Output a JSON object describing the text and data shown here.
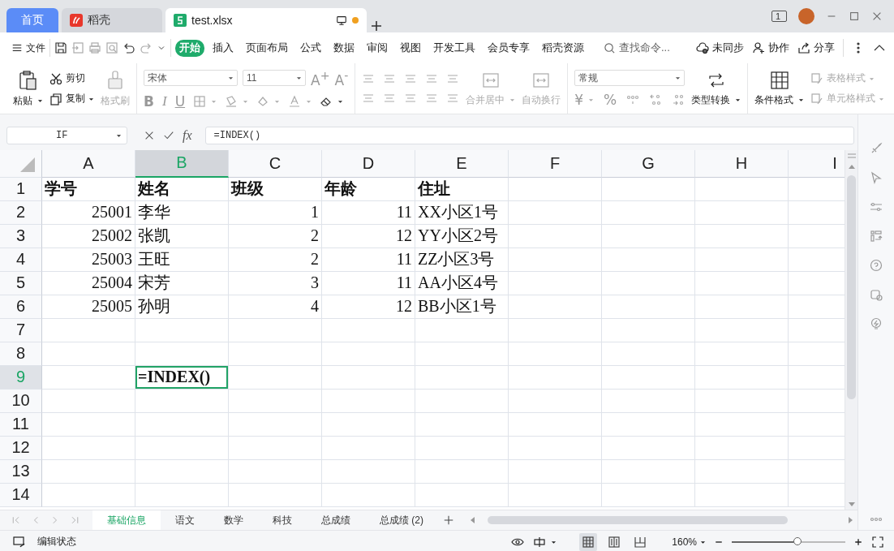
{
  "tabs": [
    {
      "label": "首页",
      "kind": "home",
      "selected": false
    },
    {
      "label": "稻壳",
      "kind": "docer",
      "selected": false
    },
    {
      "label": "test.xlsx",
      "kind": "sheet",
      "selected": true,
      "unsaved": true
    }
  ],
  "window_badge": "1",
  "menu": {
    "file": "文件",
    "tabs": [
      {
        "label": "开始",
        "selected": true
      },
      {
        "label": "插入",
        "selected": false
      },
      {
        "label": "页面布局",
        "selected": false
      },
      {
        "label": "公式",
        "selected": false
      },
      {
        "label": "数据",
        "selected": false
      },
      {
        "label": "审阅",
        "selected": false
      },
      {
        "label": "视图",
        "selected": false
      },
      {
        "label": "开发工具",
        "selected": false
      },
      {
        "label": "会员专享",
        "selected": false
      },
      {
        "label": "稻壳资源",
        "selected": false
      }
    ],
    "search": {
      "placeholder": "查找命令..."
    },
    "actions": [
      "未同步",
      "协作",
      "分享"
    ]
  },
  "ribbon": {
    "clipboard": [
      {
        "label": "粘贴",
        "disabled": false
      },
      {
        "label": "剪切",
        "disabled": false
      },
      {
        "label": "复制",
        "disabled": false
      },
      {
        "label": "格式刷",
        "disabled": true
      }
    ],
    "font_name": "宋体",
    "font_size": "11",
    "font_letters": [
      "A$^{+}$",
      "A$^{-}$",
      "B",
      "I",
      "U"
    ],
    "alignment": [
      {
        "label": "合并居中",
        "disabled": true
      },
      {
        "label": "自动换行",
        "disabled": true
      }
    ],
    "number_format": "常规",
    "number_symbols": [
      "¥",
      "%"
    ],
    "convert": {
      "label": "类型转换",
      "disabled": false
    },
    "styles": [
      {
        "label": "条件格式",
        "disabled": false
      },
      {
        "label": "表格样式",
        "disabled": true
      },
      {
        "label": "单元格样式",
        "disabled": true
      }
    ]
  },
  "formula_bar": {
    "name_box": "IF",
    "function_label": "fx",
    "formula": "=INDEX()"
  },
  "grid": {
    "columns": [
      {
        "label": "A",
        "selected": false
      },
      {
        "label": "B",
        "selected": true
      },
      {
        "label": "C",
        "selected": false
      },
      {
        "label": "D",
        "selected": false
      },
      {
        "label": "E",
        "selected": false
      },
      {
        "label": "F",
        "selected": false
      },
      {
        "label": "G",
        "selected": false
      },
      {
        "label": "H",
        "selected": false
      },
      {
        "label": "I",
        "selected": false
      }
    ],
    "rows": [
      {
        "label": "1",
        "selected": false,
        "cells": [
          {
            "text": "学号",
            "kind": "header"
          },
          {
            "text": "姓名",
            "kind": "header"
          },
          {
            "text": "班级",
            "kind": "header"
          },
          {
            "text": "年龄",
            "kind": "header"
          },
          {
            "text": "住址",
            "kind": "header"
          }
        ]
      },
      {
        "label": "2",
        "selected": false,
        "cells": [
          {
            "text": "25001",
            "kind": "number"
          },
          {
            "text": "李华",
            "kind": "text"
          },
          {
            "text": "1",
            "kind": "number"
          },
          {
            "text": "11",
            "kind": "number"
          },
          {
            "text": "XX小区1号",
            "kind": "text"
          }
        ]
      },
      {
        "label": "3",
        "selected": false,
        "cells": [
          {
            "text": "25002",
            "kind": "number"
          },
          {
            "text": "张凯",
            "kind": "text"
          },
          {
            "text": "2",
            "kind": "number"
          },
          {
            "text": "12",
            "kind": "number"
          },
          {
            "text": "YY小区2号",
            "kind": "text"
          }
        ]
      },
      {
        "label": "4",
        "selected": false,
        "cells": [
          {
            "text": "25003",
            "kind": "number"
          },
          {
            "text": "王旺",
            "kind": "text"
          },
          {
            "text": "2",
            "kind": "number"
          },
          {
            "text": "11",
            "kind": "number"
          },
          {
            "text": "ZZ小区3号",
            "kind": "text"
          }
        ]
      },
      {
        "label": "5",
        "selected": false,
        "cells": [
          {
            "text": "25004",
            "kind": "number"
          },
          {
            "text": "宋芳",
            "kind": "text"
          },
          {
            "text": "3",
            "kind": "number"
          },
          {
            "text": "11",
            "kind": "number"
          },
          {
            "text": "AA小区4号",
            "kind": "text"
          }
        ]
      },
      {
        "label": "6",
        "selected": false,
        "cells": [
          {
            "text": "25005",
            "kind": "number"
          },
          {
            "text": "孙明",
            "kind": "text"
          },
          {
            "text": "4",
            "kind": "number"
          },
          {
            "text": "12",
            "kind": "number"
          },
          {
            "text": "BB小区1号",
            "kind": "text"
          }
        ]
      },
      {
        "label": "7",
        "selected": false,
        "cells": []
      },
      {
        "label": "8",
        "selected": false,
        "cells": []
      },
      {
        "label": "9",
        "selected": true,
        "cells": [
          null,
          {
            "text": "=INDEX()",
            "kind": "editing"
          }
        ]
      },
      {
        "label": "10",
        "selected": false,
        "cells": []
      },
      {
        "label": "11",
        "selected": false,
        "cells": []
      },
      {
        "label": "12",
        "selected": false,
        "cells": []
      },
      {
        "label": "13",
        "selected": false,
        "cells": []
      },
      {
        "label": "14",
        "selected": false,
        "cells": []
      }
    ]
  },
  "sheets": [
    {
      "label": "基础信息",
      "selected": true
    },
    {
      "label": "语文",
      "selected": false
    },
    {
      "label": "数学",
      "selected": false
    },
    {
      "label": "科技",
      "selected": false
    },
    {
      "label": "总成绩",
      "selected": false
    },
    {
      "label": "总成绩 (2)",
      "selected": false
    }
  ],
  "status": {
    "mode": "编辑状态",
    "zoom": "160%",
    "views": [
      {
        "selected": true
      },
      {
        "selected": false
      },
      {
        "selected": false
      }
    ],
    "zoom_slider": {
      "level": 0.58
    }
  }
}
